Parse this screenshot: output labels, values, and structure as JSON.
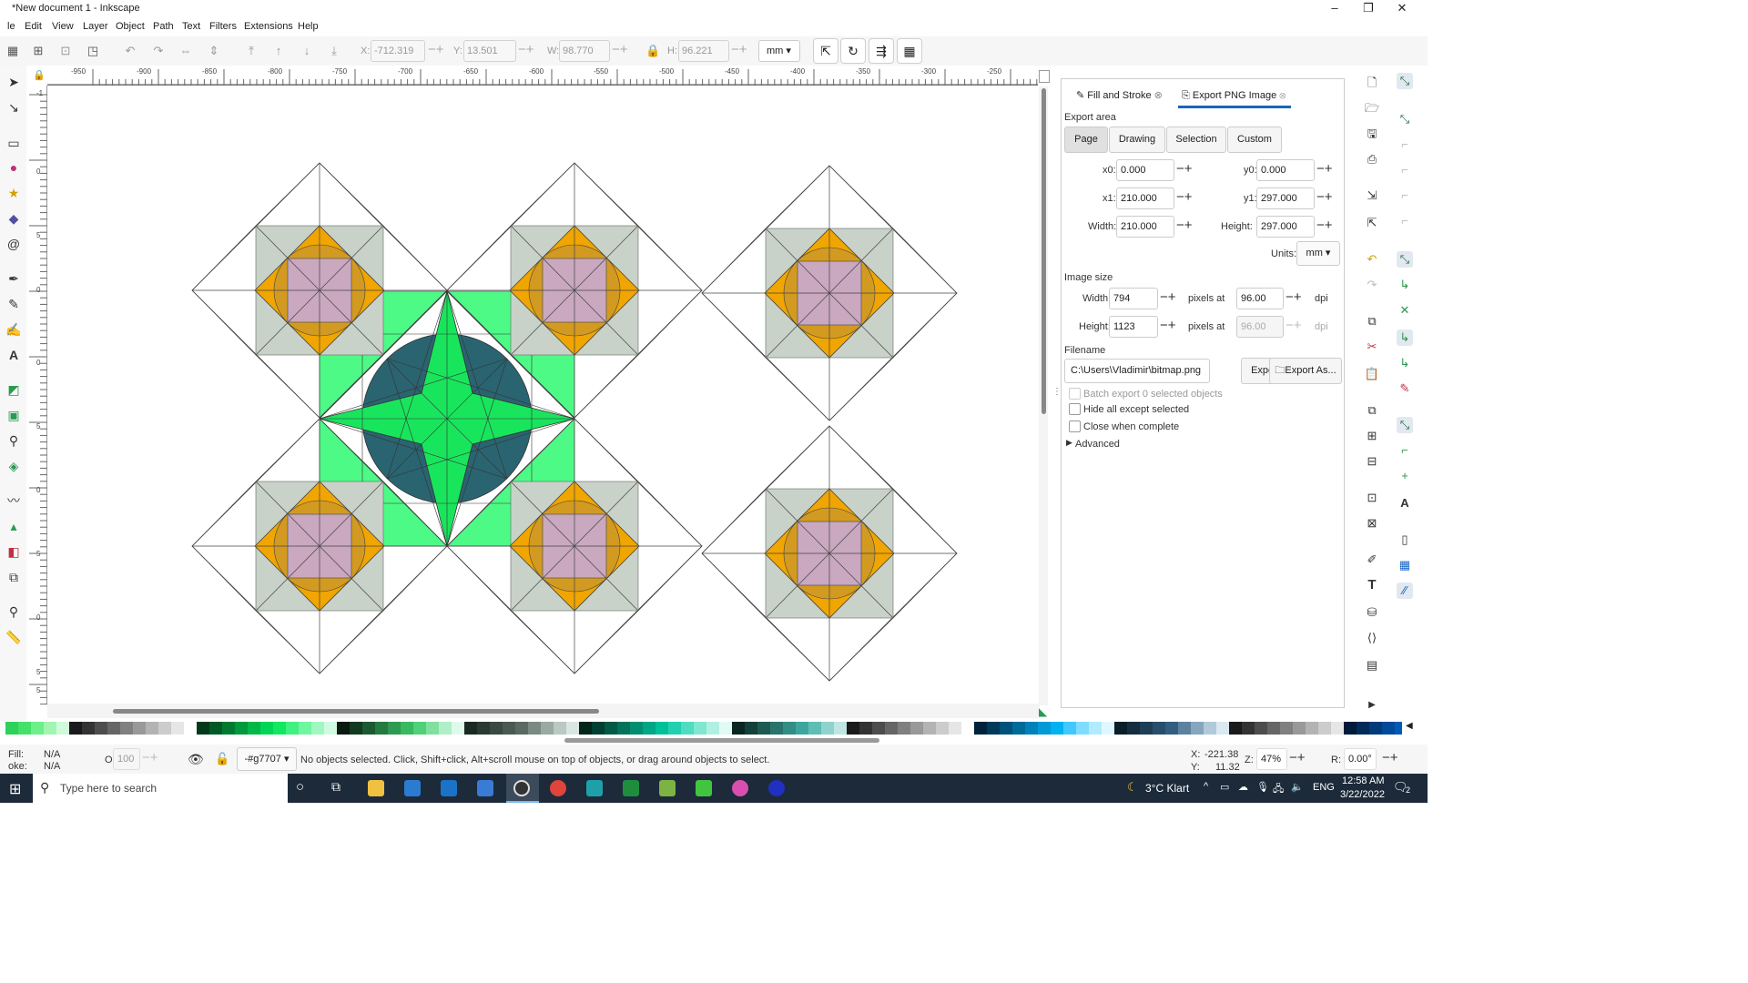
{
  "window": {
    "title": "*New document 1 - Inkscape",
    "minimize": "–",
    "restore": "❐",
    "close": "✕"
  },
  "menu": [
    "le",
    "Edit",
    "View",
    "Layer",
    "Object",
    "Path",
    "Text",
    "Filters",
    "Extensions",
    "Help"
  ],
  "toolbar": {
    "x_label": "X:",
    "x_value": "-712.319",
    "y_label": "Y:",
    "y_value": "13.501",
    "w_label": "W:",
    "w_value": "98.770",
    "h_label": "H:",
    "h_value": "96.221",
    "unit": "mm"
  },
  "ruler": {
    "h_labels": [
      "-950",
      "-900",
      "-850",
      "-800",
      "-750",
      "-700",
      "-650",
      "-600",
      "-550",
      "-500",
      "-450",
      "-400",
      "-350",
      "-300",
      "-250"
    ],
    "v_labels": [
      "-1",
      "0",
      "5",
      "0",
      "5",
      "0",
      "5",
      "0",
      "5",
      "0",
      "5"
    ]
  },
  "dock": {
    "tabs": [
      "Fill and Stroke",
      "Export PNG Image"
    ],
    "export_area_title": "Export area",
    "area_buttons": [
      "Page",
      "Drawing",
      "Selection",
      "Custom"
    ],
    "x0_label": "x0:",
    "x0": "0.000",
    "y0_label": "y0:",
    "y0": "0.000",
    "x1_label": "x1:",
    "x1": "210.000",
    "y1_label": "y1:",
    "y1": "297.000",
    "width_label": "Width:",
    "width": "210.000",
    "height_label": "Height:",
    "height": "297.000",
    "units_label": "Units:",
    "units": "mm",
    "image_size_title": "Image size",
    "img_width_label": "Width:",
    "img_width": "794",
    "img_height_label": "Height:",
    "img_height": "1123",
    "pixels_at": "pixels at",
    "dpi_w": "96.00",
    "dpi_h": "96.00",
    "dpi_label": "dpi",
    "filename_title": "Filename",
    "filename": "C:\\Users\\Vladimir\\bitmap.png",
    "export_button": "Export",
    "export_as_button": "Export As...",
    "batch_export": "Batch export 0 selected objects",
    "hide_all": "Hide all except selected",
    "close_when_complete": "Close when complete",
    "advanced": "Advanced"
  },
  "status": {
    "fill_label": "Fill:",
    "fill_value": "N/A",
    "stroke_label": "oke:",
    "stroke_value": "N/A",
    "opacity_label": "O:",
    "opacity_value": "100",
    "layer": "-#g7707",
    "message": "No objects selected. Click, Shift+click, Alt+scroll mouse on top of objects, or drag around objects to select.",
    "x_coord_label": "X:",
    "x_coord": "-221.38",
    "y_coord_label": "Y:",
    "y_coord": "11.32",
    "zoom_label": "Z:",
    "zoom": "47%",
    "rotate_label": "R:",
    "rotate": "0.00°"
  },
  "taskbar": {
    "search_placeholder": "Type here to search",
    "weather": "3°C  Klart",
    "lang": "ENG",
    "time": "12:58 AM",
    "date": "3/22/2022",
    "notifications": "2"
  },
  "colors": {
    "orange": "#f0a500",
    "grey_square": "#c8d2c8",
    "pink_square": "#c9a8c0",
    "circle_orange": "#d29a20",
    "green": "#4dfa86",
    "green_star": "#19e55c",
    "teal_circle": "#2a6470",
    "accent_blue": "#1565c0"
  }
}
